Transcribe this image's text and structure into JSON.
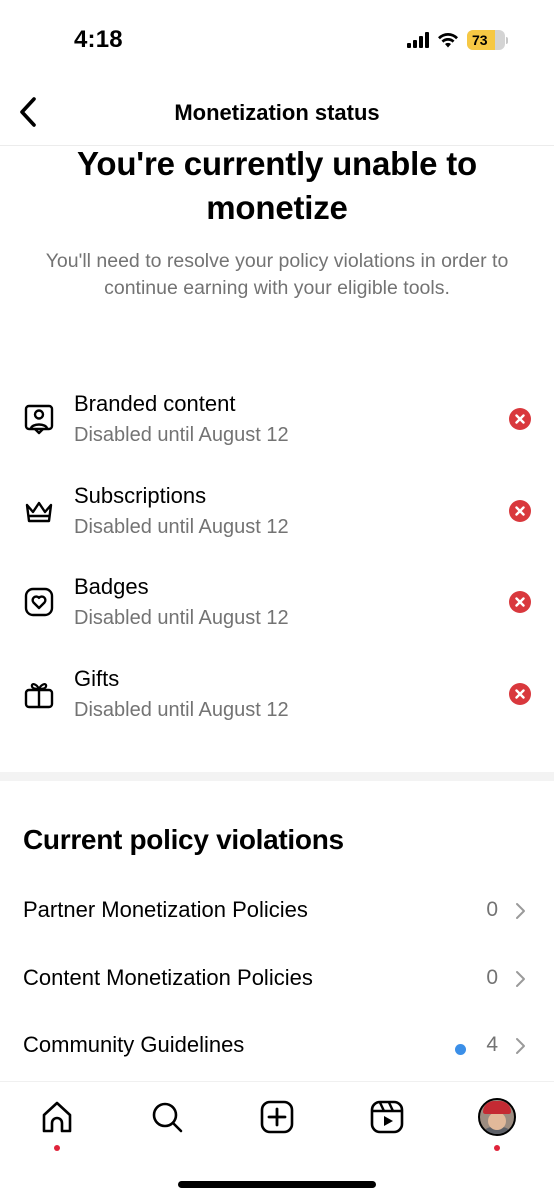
{
  "status_bar": {
    "time": "4:18",
    "battery_level": "73",
    "battery_percent": 73,
    "battery_color": "#f6c844"
  },
  "header": {
    "title": "Monetization status",
    "back_icon": "chevron-left-icon"
  },
  "hero": {
    "title": "You're currently unable to monetize",
    "subtitle": "You'll need to resolve your policy violations in order to continue earning with your eligible tools."
  },
  "tools": [
    {
      "name": "Branded content",
      "status": "Disabled until August 12",
      "icon": "branded-content-icon",
      "state_icon": "error-icon"
    },
    {
      "name": "Subscriptions",
      "status": "Disabled until August 12",
      "icon": "crown-icon",
      "state_icon": "error-icon"
    },
    {
      "name": "Badges",
      "status": "Disabled until August 12",
      "icon": "heart-badge-icon",
      "state_icon": "error-icon"
    },
    {
      "name": "Gifts",
      "status": "Disabled until August 12",
      "icon": "gift-icon",
      "state_icon": "error-icon"
    }
  ],
  "violations": {
    "title": "Current policy violations",
    "items": [
      {
        "label": "Partner Monetization Policies",
        "count": "0",
        "has_new": false
      },
      {
        "label": "Content Monetization Policies",
        "count": "0",
        "has_new": false
      },
      {
        "label": "Community Guidelines",
        "count": "4",
        "has_new": true
      }
    ]
  },
  "tab_bar": {
    "items": [
      {
        "name": "home",
        "icon": "home-icon",
        "has_notification": true
      },
      {
        "name": "search",
        "icon": "search-icon",
        "has_notification": false
      },
      {
        "name": "create",
        "icon": "plus-square-icon",
        "has_notification": false
      },
      {
        "name": "reels",
        "icon": "reels-icon",
        "has_notification": false
      },
      {
        "name": "profile",
        "icon": "avatar",
        "has_notification": true
      }
    ]
  },
  "colors": {
    "error": "#d9383d",
    "new_dot": "#3b8fe8",
    "notification_dot": "#e0233a",
    "secondary_text": "#737373"
  }
}
